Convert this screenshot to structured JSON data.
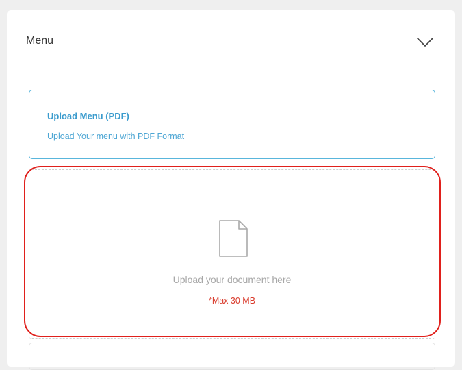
{
  "section": {
    "title": "Menu",
    "toggle_icon": "chevron-down-icon"
  },
  "upload_info": {
    "title": "Upload Menu (PDF)",
    "subtitle": "Upload Your menu with PDF Format"
  },
  "dropzone": {
    "icon": "document-icon",
    "prompt": "Upload your document here",
    "limit": "*Max 30 MB"
  },
  "colors": {
    "accent": "#3a9bcd",
    "border_accent": "#59b6dc",
    "warning": "#d93a2b",
    "highlight": "#e0201c"
  }
}
